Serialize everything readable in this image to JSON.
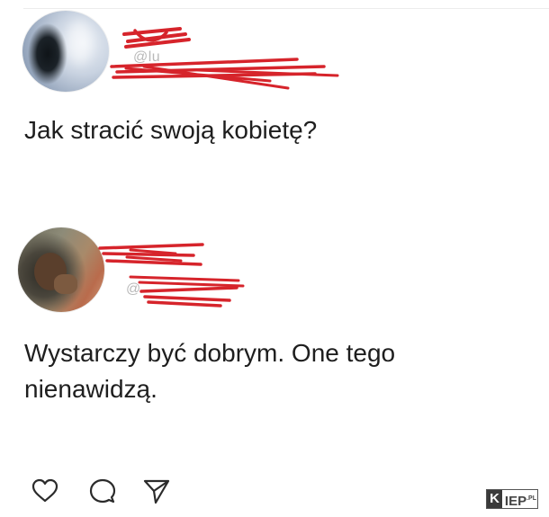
{
  "posts": [
    {
      "author_name": "",
      "author_handle": "@lu",
      "text": "Jak stracić swoją kobietę?"
    },
    {
      "author_name": "",
      "author_handle": "@",
      "text": "Wystarczy być dobrym. One tego\nnienawidzą."
    }
  ],
  "actions": [
    {
      "label": "Like",
      "icon": "heart-outline-icon"
    },
    {
      "label": "Comment",
      "icon": "comment-bubble-icon"
    },
    {
      "label": "Share",
      "icon": "paper-plane-icon"
    }
  ],
  "watermark": {
    "first_letter": "K",
    "rest": "IEP",
    "suffix": ".PL"
  },
  "colors": {
    "redaction": "#d6242b",
    "text": "#1e1e1e",
    "icon": "#2b2b2b"
  }
}
